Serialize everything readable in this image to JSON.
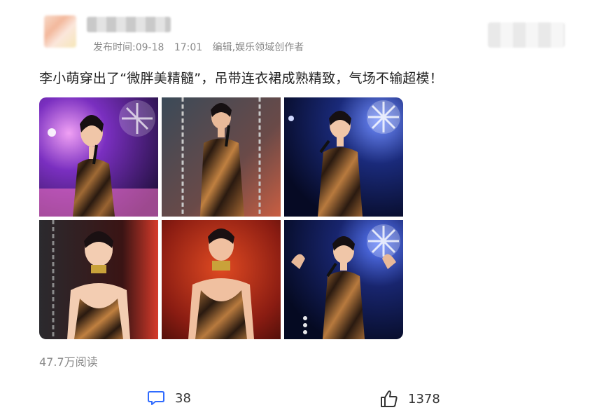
{
  "post": {
    "publish_time": "发布时间:09-18",
    "clock": "17:01",
    "author_role": "编辑,娱乐领域创作者",
    "headline": "李小萌穿出了“微胖美精髓”，吊带连衣裙成熟精致，气场不输超模！",
    "views": "47.7万阅读"
  },
  "actions": {
    "comment_count": "38",
    "like_count": "1378"
  },
  "photos": [
    {
      "name": "photo-1",
      "bg": "#3a1f6e",
      "accent": "#c95ad9"
    },
    {
      "name": "photo-2",
      "bg": "#3b4a58",
      "accent": "#d76a4a"
    },
    {
      "name": "photo-3",
      "bg": "#0d1b4a",
      "accent": "#5c7cff"
    },
    {
      "name": "photo-4",
      "bg": "#1d1010",
      "accent": "#d63a2a"
    },
    {
      "name": "photo-5",
      "bg": "#7a1a10",
      "accent": "#e04a22"
    },
    {
      "name": "photo-6",
      "bg": "#0a1240",
      "accent": "#3b5cff"
    }
  ],
  "colors": {
    "accent_blue": "#2f6bff",
    "meta_gray": "#8a8a8a"
  }
}
